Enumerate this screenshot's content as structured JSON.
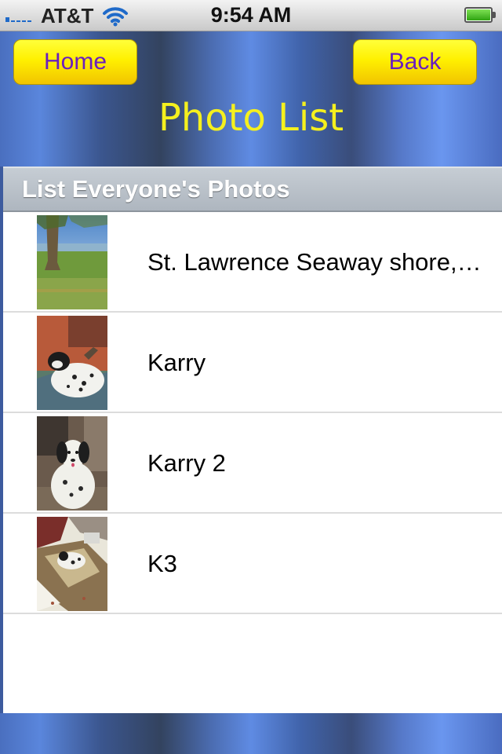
{
  "status_bar": {
    "carrier": "AT&T",
    "time": "9:54 AM",
    "battery_level": 1.0,
    "signal_bars_active": 1,
    "signal_bars_total": 5
  },
  "header": {
    "home_label": "Home",
    "back_label": "Back",
    "title": "Photo List"
  },
  "list": {
    "section_title": "List Everyone's Photos",
    "items": [
      {
        "label": "St. Lawrence Seaway shore,…",
        "thumbnail": "tree-shoreline-photo"
      },
      {
        "label": "Karry",
        "thumbnail": "dog-lying-photo"
      },
      {
        "label": "Karry 2",
        "thumbnail": "dog-sitting-photo"
      },
      {
        "label": "K3",
        "thumbnail": "dog-on-rug-photo"
      }
    ]
  },
  "colors": {
    "button_text": "#6a1fbf",
    "button_fill": "#fff000",
    "title_color": "#f5f01e",
    "header_blue": "#5a86dc"
  }
}
